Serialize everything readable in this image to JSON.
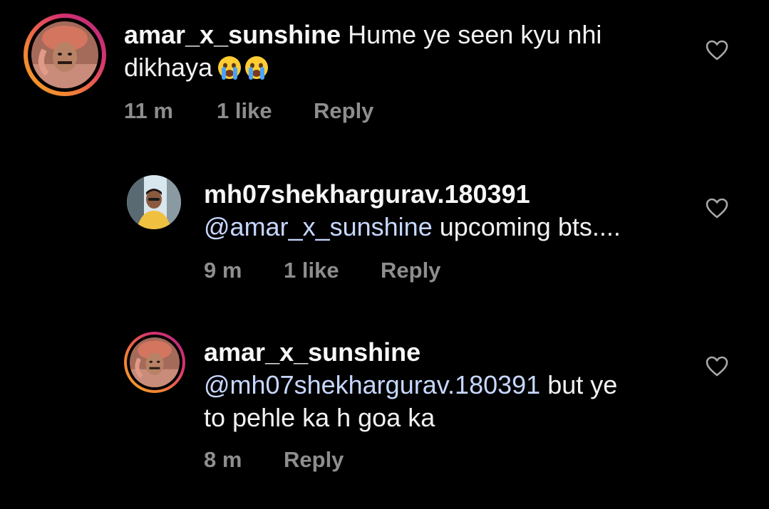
{
  "comments": [
    {
      "username": "amar_x_sunshine",
      "text": "Hume ye seen kyu nhi",
      "text_line2": "dikhaya",
      "emojis": [
        "crying-face-emoji",
        "crying-face-emoji"
      ],
      "time": "11 m",
      "likes": "1 like",
      "reply": "Reply"
    },
    {
      "username": "mh07shekhargurav.180391",
      "mention": "@amar_x_sunshine",
      "text": " upcoming bts....",
      "time": "9 m",
      "likes": "1 like",
      "reply": "Reply"
    },
    {
      "username": "amar_x_sunshine",
      "mention": "@mh07shekhargurav.180391",
      "text": " but ye",
      "text_line2": "to pehle ka h goa ka",
      "time": "8 m",
      "reply": "Reply"
    }
  ],
  "colors": {
    "background": "#000000",
    "text": "#f2f2f2",
    "meta": "#8e8e8e",
    "mention": "#c7d7ff",
    "story_ring_start": "#f5a623",
    "story_ring_end": "#b0297e"
  },
  "icons": {
    "like": "heart-outline-icon"
  }
}
